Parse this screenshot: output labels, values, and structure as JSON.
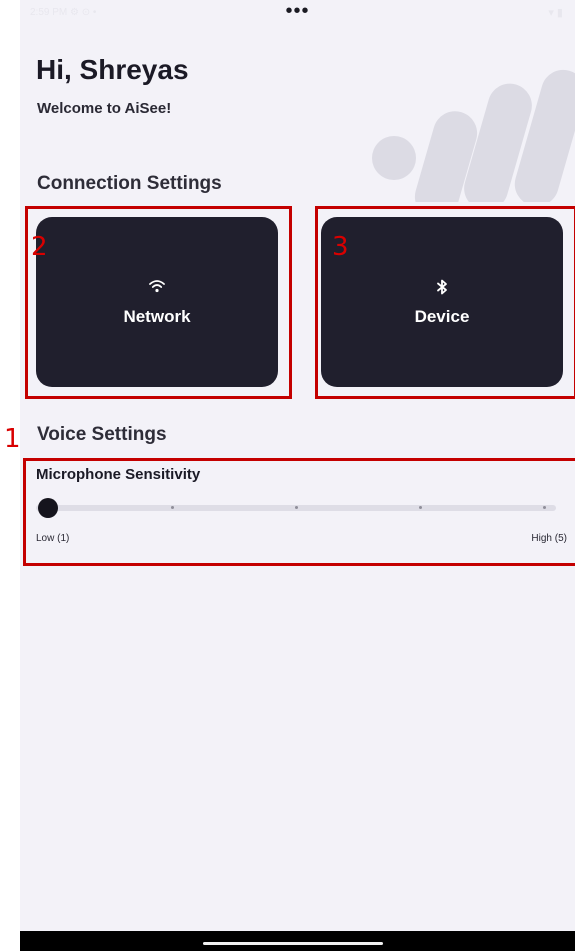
{
  "status_bar": {
    "time": "2:59 PM  ⚙  ⊙  •",
    "right_icons": "▾ ▮"
  },
  "menu_dots": "•••",
  "greeting": "Hi, Shreyas",
  "welcome": "Welcome to AiSee!",
  "connection_settings": {
    "title": "Connection Settings",
    "network": {
      "label": "Network",
      "icon": "wifi-icon",
      "annotation": "2"
    },
    "device": {
      "label": "Device",
      "icon": "bluetooth-icon",
      "annotation": "3"
    }
  },
  "voice_settings": {
    "title": "Voice Settings",
    "annotation": "1",
    "microphone": {
      "label": "Microphone Sensitivity",
      "min": 1,
      "max": 5,
      "value": 1,
      "min_label": "Low (1)",
      "max_label": "High (5)"
    }
  },
  "colors": {
    "background": "#f3f2f8",
    "card": "#201f2d",
    "annotation": "#c40000",
    "text": "#1b1a26"
  }
}
